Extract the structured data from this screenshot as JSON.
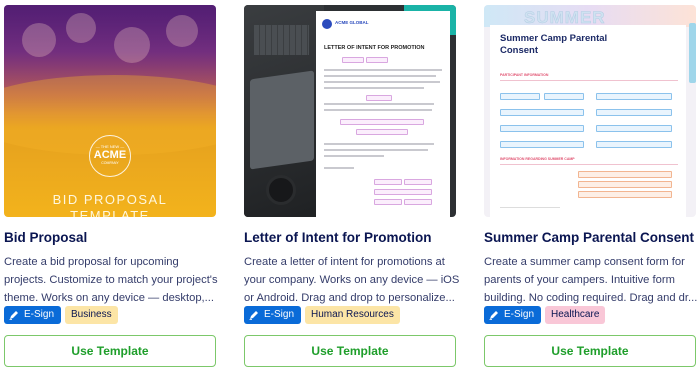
{
  "cards": [
    {
      "title": "Bid Proposal",
      "description": "Create a bid proposal for upcoming projects. Customize to match your project's theme. Works on any device — desktop,...",
      "esign_label": "E-Sign",
      "category": "Business",
      "button_label": "Use Template",
      "thumbnail": {
        "logo_top": "— THE NEW —",
        "logo_name": "ACME",
        "logo_sub": "COMPANY",
        "heading_line1": "BID PROPOSAL",
        "heading_line2": "TEMPLATE"
      }
    },
    {
      "title": "Letter of Intent for Promotion",
      "description": "Create a letter of intent for promotions at your company. Works on any device — iOS or Android. Drag and drop to personalize...",
      "esign_label": "E-Sign",
      "category": "Human Resources",
      "button_label": "Use Template",
      "thumbnail": {
        "brand": "ACME GLOBAL",
        "doc_title": "LETTER OF INTENT FOR PROMOTION"
      }
    },
    {
      "title": "Summer Camp Parental Consent",
      "description": "Create a summer camp consent form for parents of your campers. Intuitive form building. No coding required. Drag and dr...",
      "esign_label": "E-Sign",
      "category": "Healthcare",
      "button_label": "Use Template",
      "thumbnail": {
        "banner": "SUMMER",
        "form_title_line1": "Summer Camp Parental",
        "form_title_line2": "Consent",
        "section1": "PARTICIPANT INFORMATION",
        "section2": "INFORMATION REGARDING SUMMER CAMP"
      }
    }
  ],
  "colors": {
    "esign_bg": "#0a6bd8",
    "business_bg": "#fce5a6",
    "hr_bg": "#fce5a6",
    "healthcare_bg": "#f9c7d7",
    "button_border": "#7cc86a",
    "button_text": "#1e9e2a",
    "title_text": "#0a1551"
  }
}
